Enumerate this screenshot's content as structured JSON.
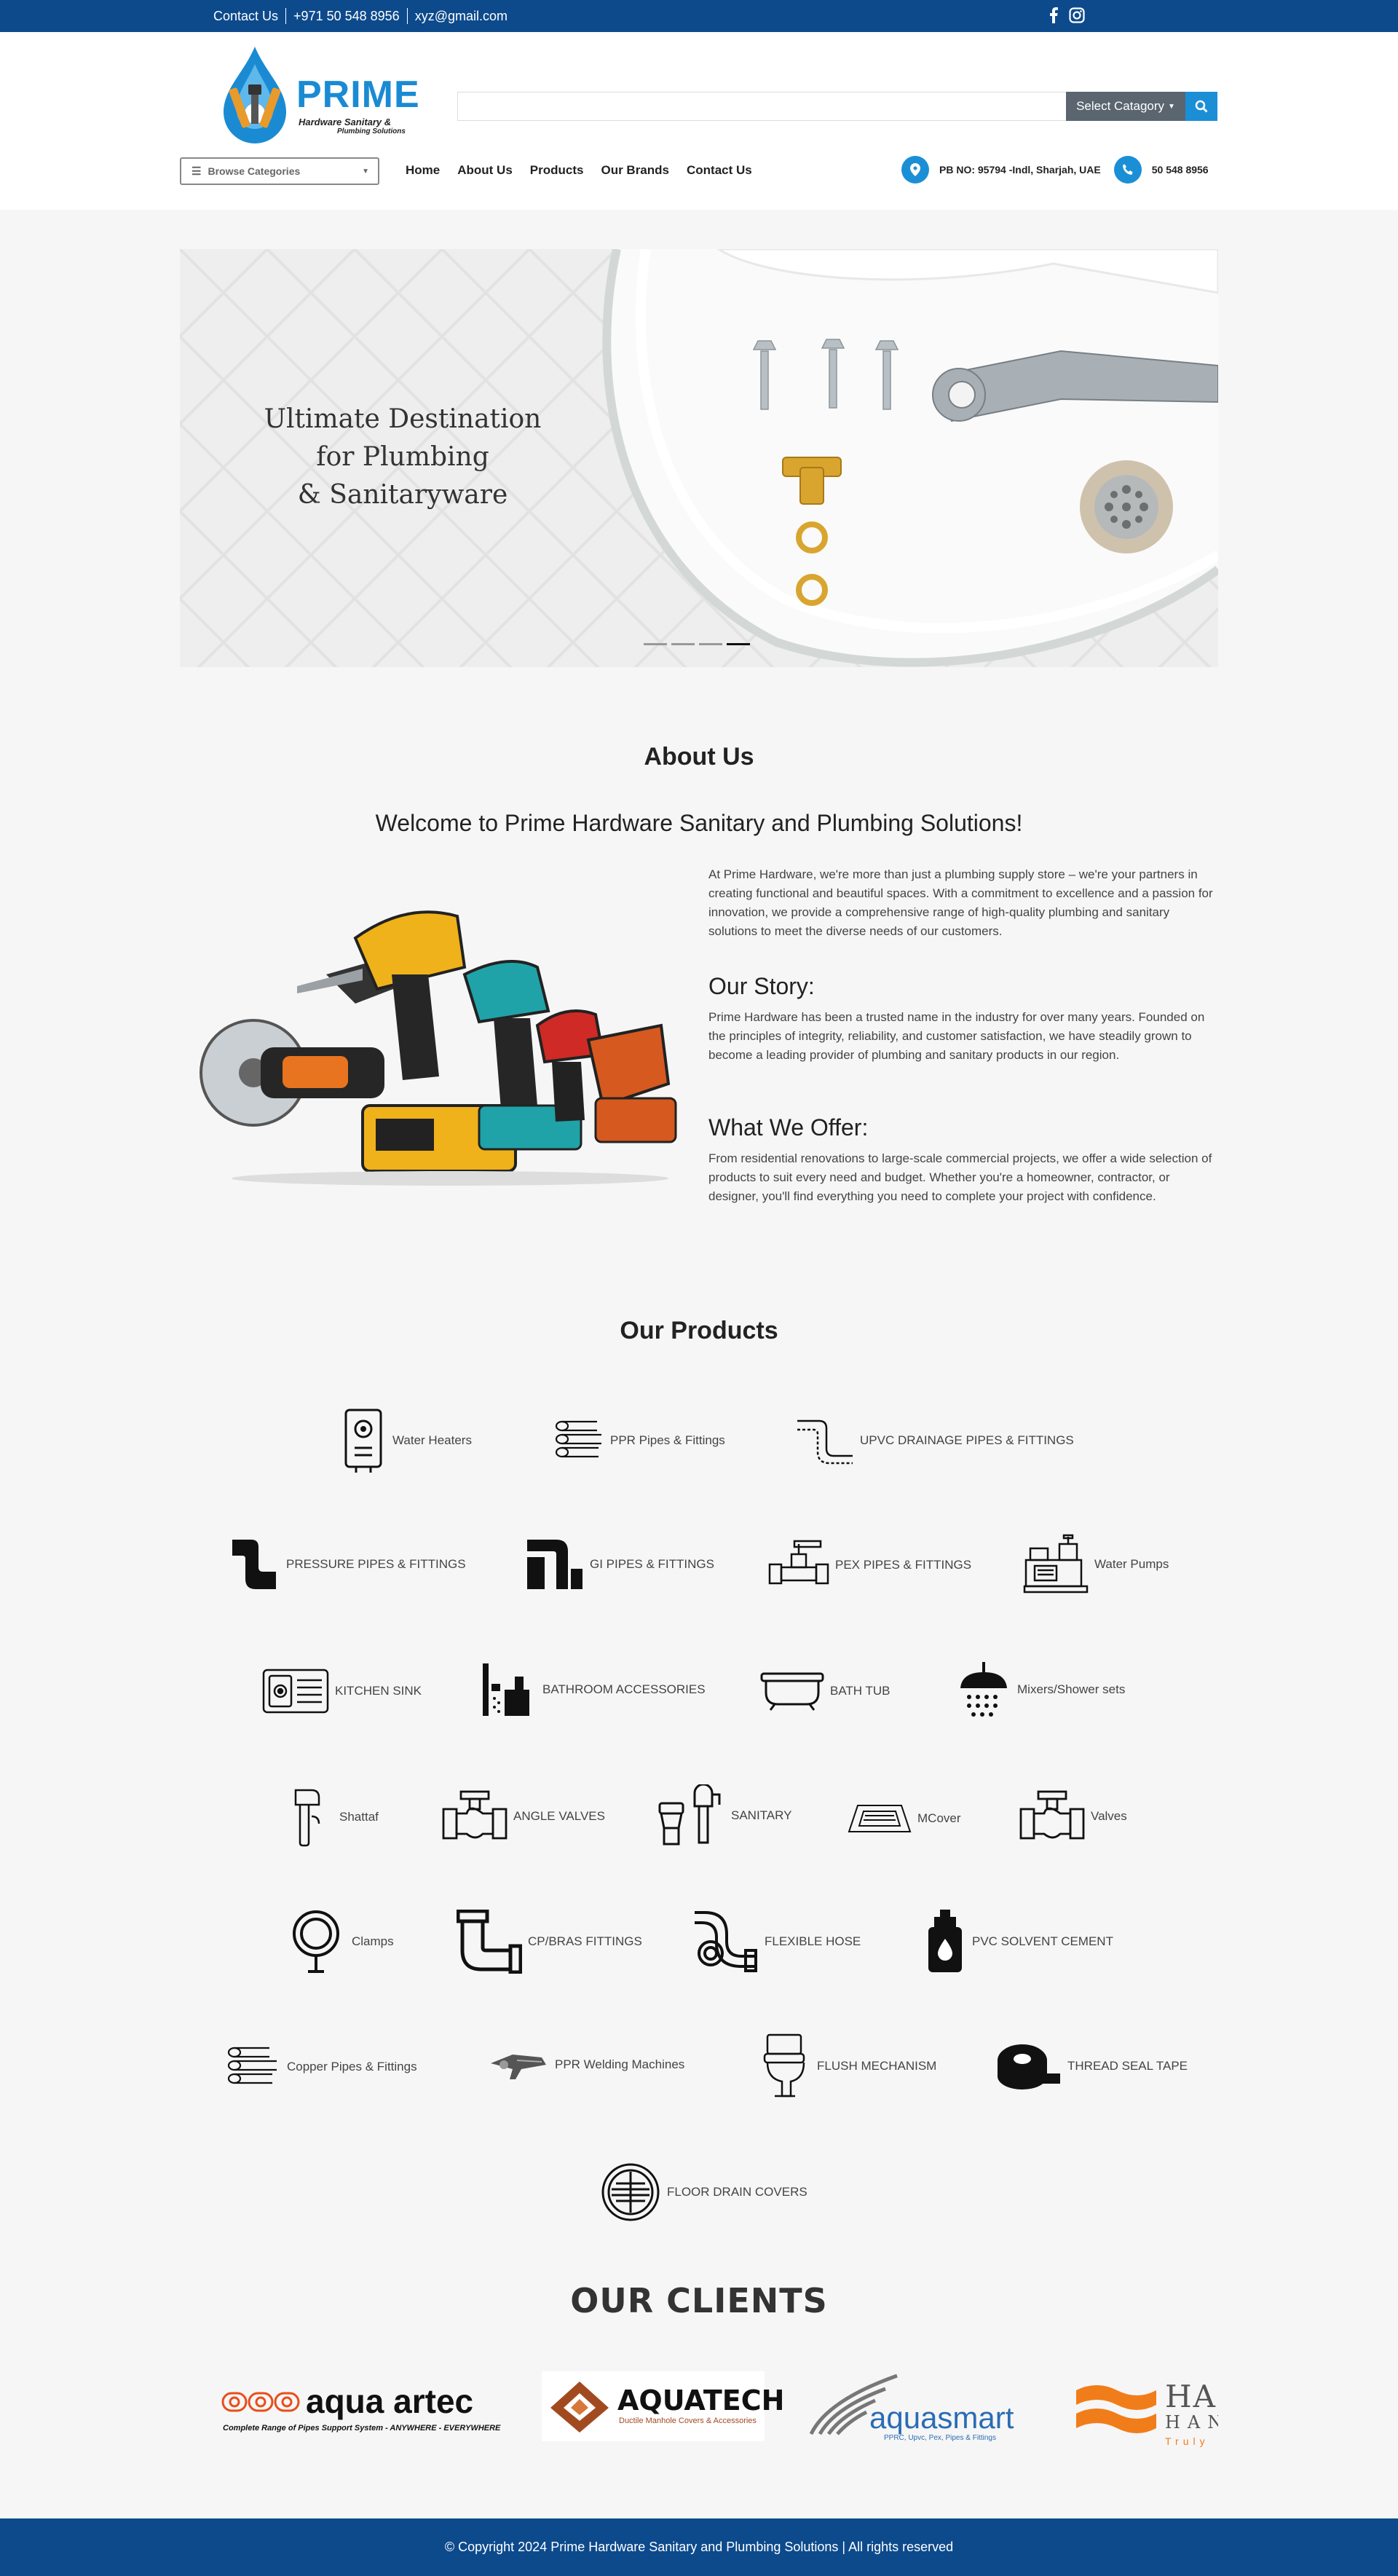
{
  "topbar": {
    "links": [
      "Contact Us",
      "+971 50 548 8956",
      "xyz@gmail.com"
    ],
    "social": [
      "facebook-icon",
      "instagram-icon"
    ]
  },
  "header": {
    "logo": {
      "brand": "PRIME",
      "line1": "Hardware Sanitary &",
      "line2": "Plumbing Solutions"
    },
    "search": {
      "placeholder": "",
      "category_label": "Select Catagory"
    },
    "browse_label": "Browse Categories",
    "nav": [
      "Home",
      "About Us",
      "Products",
      "Our Brands",
      "Contact Us"
    ],
    "address": "PB NO: 95794 -Indl, Sharjah, UAE",
    "phone": "50 548 8956"
  },
  "hero": {
    "line1": "Ultimate Destination",
    "line2": "for Plumbing",
    "line3": "& Sanitaryware",
    "slides": 4,
    "active_slide": 4
  },
  "about": {
    "title": "About Us",
    "welcome": "Welcome to Prime Hardware Sanitary and Plumbing Solutions!",
    "intro": "At Prime Hardware, we're more than just a plumbing supply store – we're your partners in creating functional and beautiful spaces. With a commitment to excellence and a passion for innovation, we provide a comprehensive range of high-quality plumbing and sanitary solutions to meet the diverse needs of our customers.",
    "story_title": "Our Story:",
    "story": "Prime Hardware has been a trusted name in the industry for over many years. Founded on the principles of integrity, reliability, and customer satisfaction, we have steadily grown to become a leading provider of plumbing and sanitary products in our region.",
    "offer_title": "What We Offer:",
    "offer": "From residential renovations to large-scale commercial projects, we offer a wide selection of products to suit every need and budget. Whether you're a homeowner, contractor, or designer, you'll find everything you need to complete your project with confidence."
  },
  "products": {
    "title": "Our Products",
    "items": [
      "Water Heaters",
      "PPR Pipes & Fittings",
      "UPVC DRAINAGE PIPES & FITTINGS",
      "PRESSURE PIPES & FITTINGS",
      "GI PIPES & FITTINGS",
      "PEX PIPES & FITTINGS",
      "Water Pumps",
      "KITCHEN SINK",
      "BATHROOM ACCESSORIES",
      "BATH TUB",
      "Mixers/Shower sets",
      "Shattaf",
      "ANGLE VALVES",
      "SANITARY",
      "MCover",
      "Valves",
      "Clamps",
      "CP/BRAS FITTINGS",
      "FLEXIBLE HOSE",
      "PVC SOLVENT CEMENT",
      "Copper Pipes & Fittings",
      "PPR Welding Machines",
      "FLUSH MECHANISM",
      "THREAD SEAL TAPE",
      "FLOOR DRAIN COVERS"
    ]
  },
  "clients": {
    "title": "OUR CLIENTS",
    "logos": [
      {
        "name": "aqua artec",
        "tagline": "Complete Range of Pipes Support System - ANYWHERE - EVERYWHERE"
      },
      {
        "name": "AQUATECH",
        "tagline": "Ductile Manhole Covers & Accessories"
      },
      {
        "name": "aquasmart",
        "tagline": "PPRC, Upvc, Pex, Pipes & Fittings"
      },
      {
        "name": "HAN",
        "tagline": "HAN",
        "tagline2": "Truly"
      }
    ]
  },
  "footer": {
    "copyright": "© Copyright 2024 Prime Hardware Sanitary and Plumbing Solutions | All rights reserved"
  },
  "colors": {
    "primary": "#0d4a8c",
    "accent": "#1b8fd6",
    "category_btn": "#5a6570"
  }
}
